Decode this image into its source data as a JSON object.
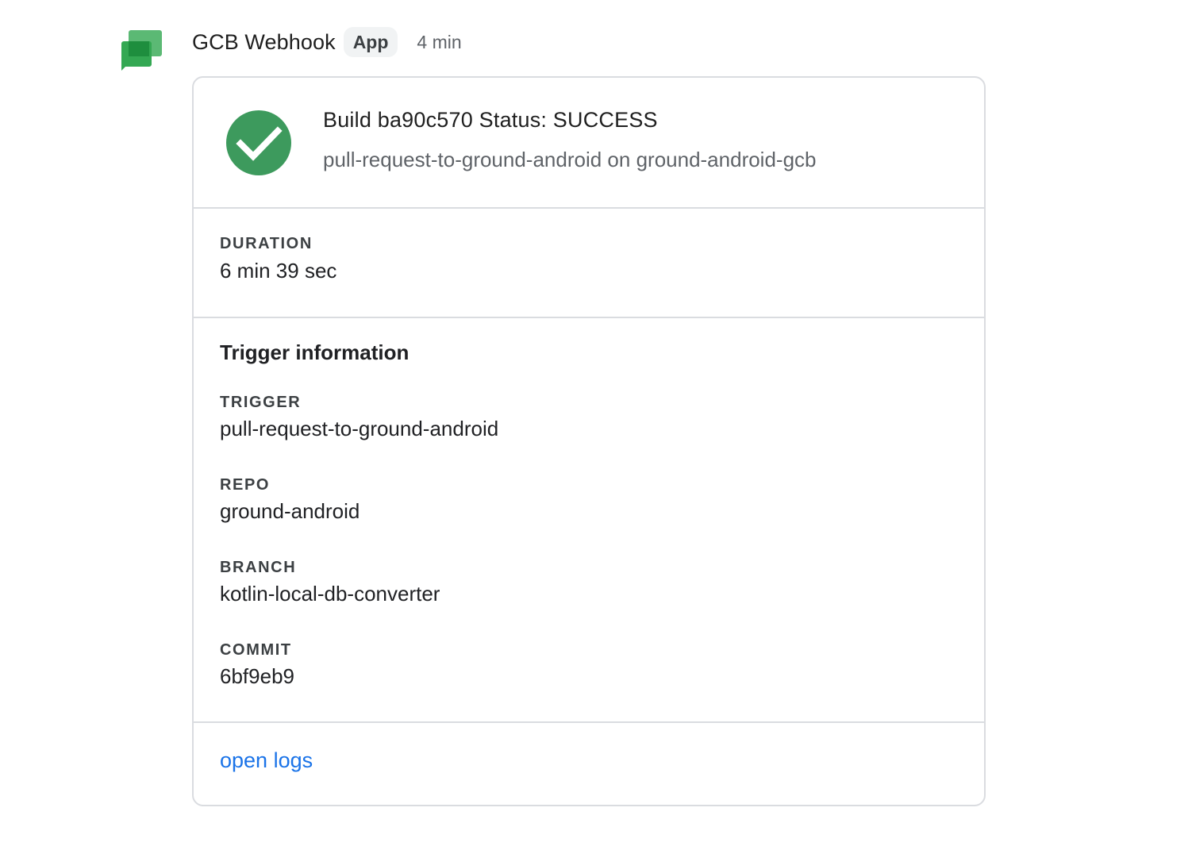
{
  "sender": {
    "name": "GCB Webhook",
    "badge": "App",
    "timestamp": "4 min",
    "avatar_icon": "google-chat-icon",
    "avatar_colors": {
      "front": "#34a853",
      "back": "#5bb974",
      "overlap": "#1e8e3e"
    }
  },
  "card": {
    "header": {
      "title": "Build ba90c570 Status: SUCCESS",
      "subtitle": "pull-request-to-ground-android on ground-android-gcb",
      "status_icon": "check-circle-icon",
      "status_color": "#3d9a5d"
    },
    "duration": {
      "label": "DURATION",
      "value": "6 min 39 sec"
    },
    "trigger_section": {
      "heading": "Trigger information",
      "fields": [
        {
          "label": "TRIGGER",
          "value": "pull-request-to-ground-android"
        },
        {
          "label": "REPO",
          "value": "ground-android"
        },
        {
          "label": "BRANCH",
          "value": "kotlin-local-db-converter"
        },
        {
          "label": "COMMIT",
          "value": "6bf9eb9"
        }
      ]
    },
    "actions": {
      "open_logs_label": "open logs",
      "link_color": "#1a73e8"
    }
  }
}
